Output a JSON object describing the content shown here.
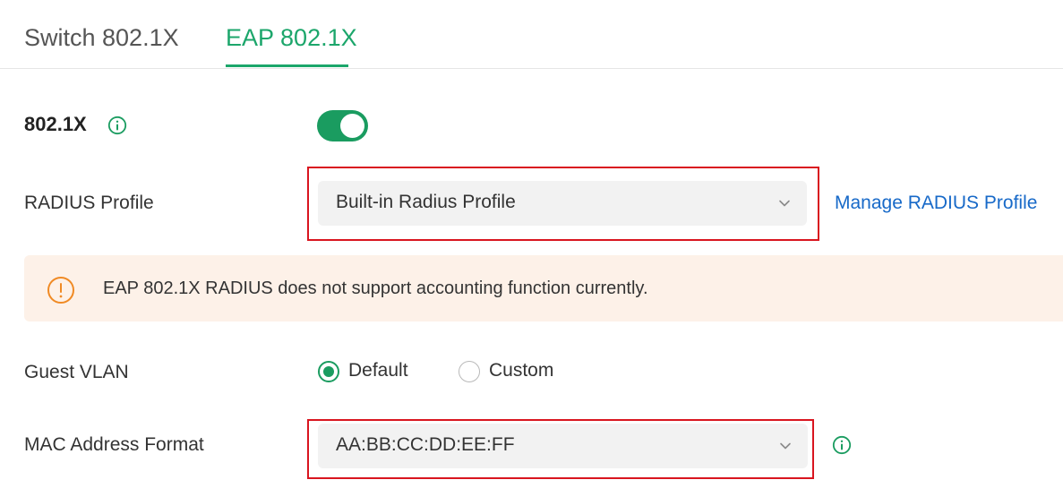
{
  "tabs": [
    {
      "label": "Switch 802.1X",
      "active": false
    },
    {
      "label": "EAP 802.1X",
      "active": true
    }
  ],
  "fields": {
    "dot1x": {
      "label": "802.1X",
      "enabled": true
    },
    "radius_profile": {
      "label": "RADIUS Profile",
      "value": "Built-in Radius Profile",
      "manage_link": "Manage RADIUS Profile"
    },
    "warning": {
      "text": "EAP 802.1X RADIUS does not support accounting function currently."
    },
    "guest_vlan": {
      "label": "Guest VLAN",
      "options": [
        {
          "label": "Default",
          "selected": true
        },
        {
          "label": "Custom",
          "selected": false
        }
      ]
    },
    "mac_format": {
      "label": "MAC Address Format",
      "value": "AA:BB:CC:DD:EE:FF"
    }
  },
  "icons": {
    "info": "info-circle-icon",
    "warning": "exclamation-circle-icon",
    "dropdown": "chevron-down-icon"
  },
  "colors": {
    "accent": "#1a9c60",
    "link": "#1769c8",
    "highlight": "#d9151f",
    "warning_bg": "#fdf1e8",
    "warning_icon": "#f08a24"
  }
}
